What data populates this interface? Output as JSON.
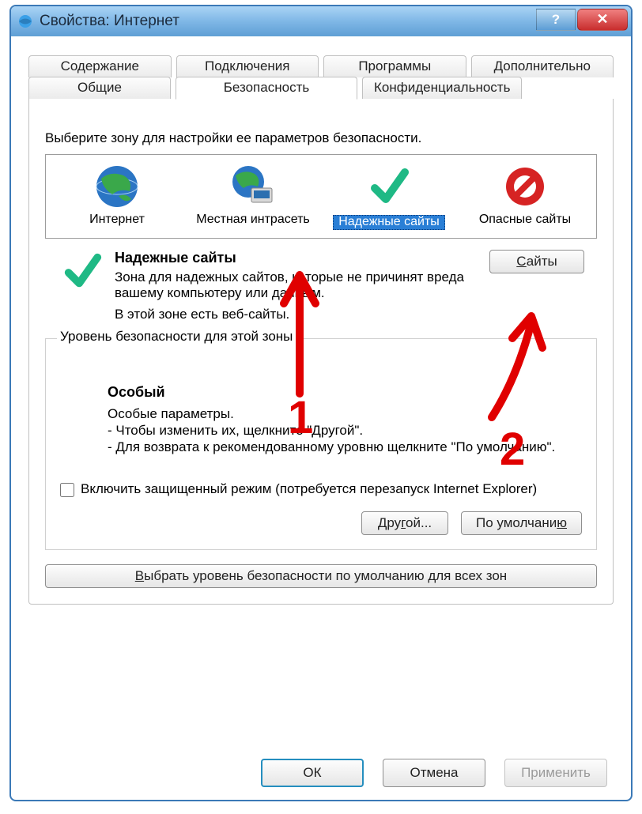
{
  "window": {
    "title": "Свойства: Интернет"
  },
  "tabs_top": [
    {
      "label": "Содержание"
    },
    {
      "label": "Подключения"
    },
    {
      "label": "Программы"
    },
    {
      "label": "Дополнительно"
    }
  ],
  "tabs_bottom": [
    {
      "label": "Общие"
    },
    {
      "label": "Безопасность"
    },
    {
      "label": "Конфиденциальность"
    }
  ],
  "zone_caption": "Выберите зону для настройки ее параметров безопасности.",
  "zones": [
    {
      "label": "Интернет"
    },
    {
      "label": "Местная интрасеть"
    },
    {
      "label": "Надежные сайты"
    },
    {
      "label": "Опасные сайты"
    }
  ],
  "zone_desc": {
    "title": "Надежные сайты",
    "body": "Зона для надежных сайтов, которые не причинят вреда вашему компьютеру или данным.",
    "note": "В этой зоне есть веб-сайты."
  },
  "sites_btn": "Сайты",
  "group_title": "Уровень безопасности для этой зоны",
  "level": {
    "title": "Особый",
    "line1": "Особые параметры.",
    "line2": "- Чтобы изменить их, щелкните \"Другой\".",
    "line3": "- Для возврата к рекомендованному уровню щелкните \"По умолчанию\"."
  },
  "protected_mode": "Включить защищенный режим (потребуется перезапуск Internet Explorer)",
  "btn_custom": "Другой...",
  "btn_default": "По умолчанию",
  "btn_reset_all": "Выбрать уровень безопасности по умолчанию для всех зон",
  "footer": {
    "ok": "ОК",
    "cancel": "Отмена",
    "apply": "Применить"
  },
  "annotations": {
    "one": "1",
    "two": "2"
  }
}
